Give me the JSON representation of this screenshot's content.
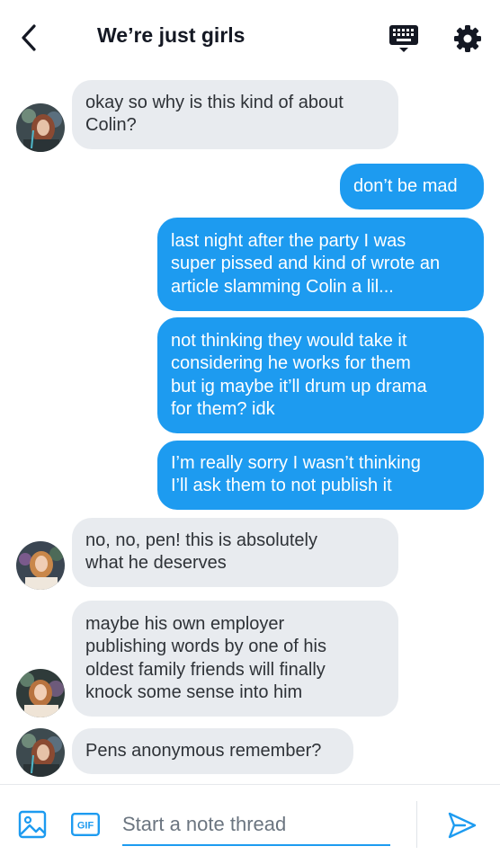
{
  "header": {
    "title": "We’re just girls",
    "back_icon": "chevron-left-icon",
    "keyboard_icon": "keyboard-icon",
    "settings_icon": "gear-icon"
  },
  "messages": [
    {
      "side": "in",
      "lines": [
        "okay so why is this kind of about",
        "Colin?"
      ]
    },
    {
      "side": "out",
      "lines": [
        "don’t be mad"
      ]
    },
    {
      "side": "out",
      "lines": [
        "last night after the party I was",
        "super pissed and kind of wrote an",
        "article slamming Colin a lil..."
      ]
    },
    {
      "side": "out",
      "lines": [
        "not thinking they would take it",
        "considering he works for them",
        "but ig maybe it’ll drum up drama",
        "for them? idk"
      ]
    },
    {
      "side": "out",
      "lines": [
        "I’m really sorry I wasn’t thinking",
        "I’ll ask them to not publish it"
      ]
    },
    {
      "side": "in",
      "lines": [
        "no, no, pen! this is absolutely",
        "what he deserves"
      ]
    },
    {
      "side": "in",
      "lines": [
        "maybe his own employer",
        "publishing words by one of his",
        "oldest family friends will finally",
        "knock some sense into him"
      ]
    },
    {
      "side": "in",
      "lines": [
        "Pens anonymous remember?"
      ]
    }
  ],
  "composer": {
    "placeholder": "Start a note thread",
    "gif_label": "GIF",
    "image_icon": "image-icon",
    "send_icon": "send-icon"
  },
  "colors": {
    "outgoing_bubble": "#1d9bf0",
    "incoming_bubble": "#e8ebef",
    "accent": "#1d9bf0"
  }
}
